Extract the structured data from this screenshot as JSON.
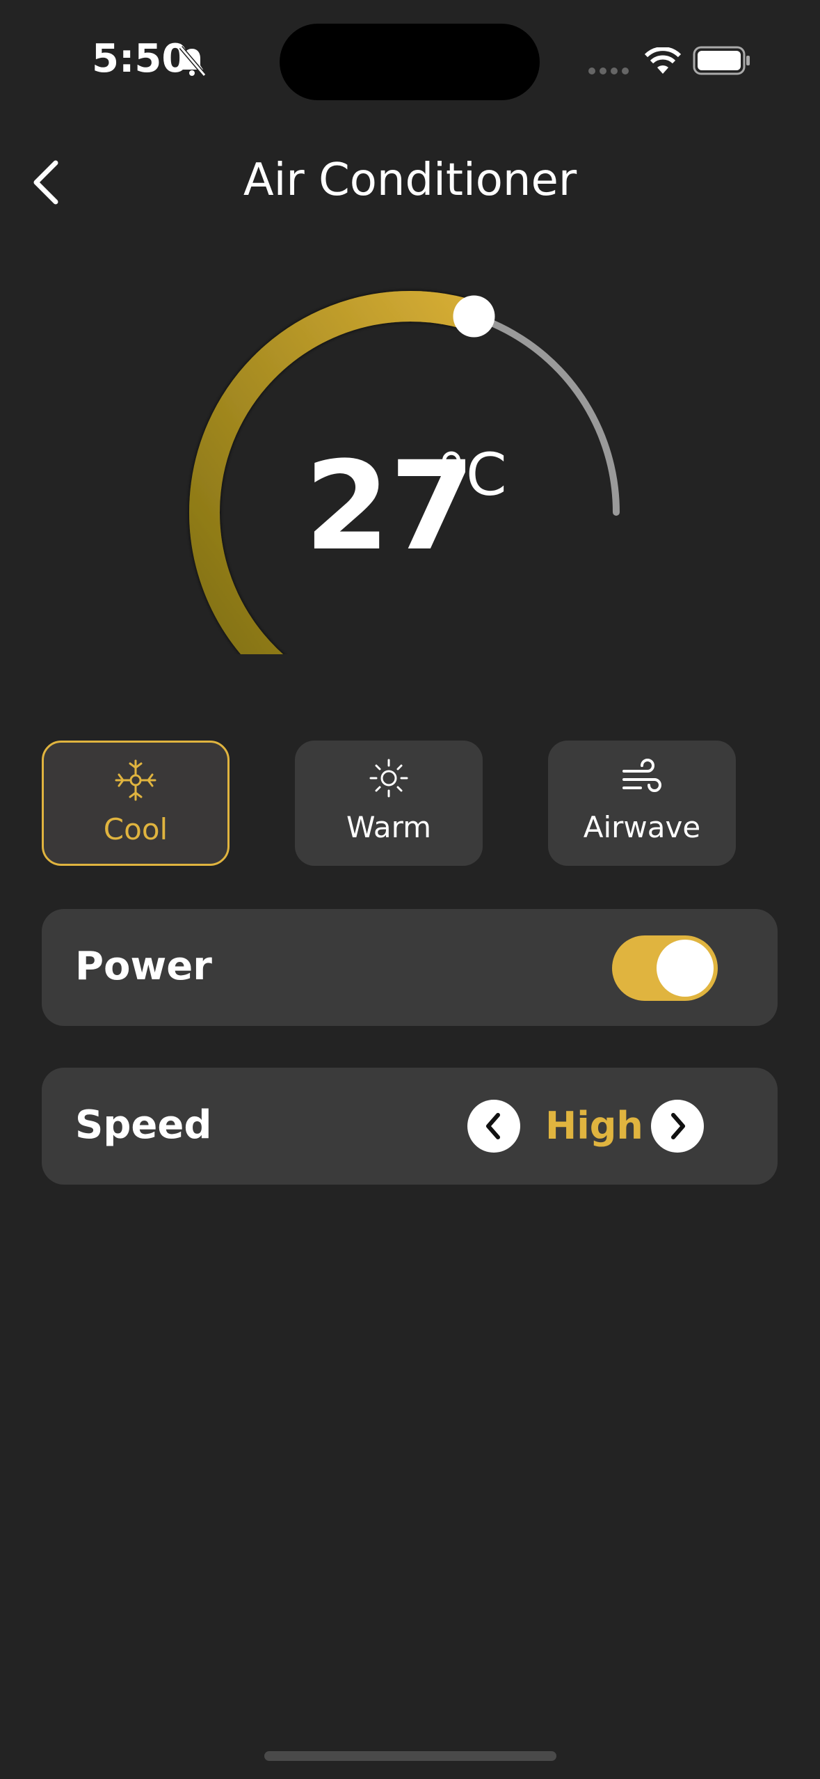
{
  "status_bar": {
    "time": "5:50"
  },
  "header": {
    "title": "Air Conditioner"
  },
  "thermostat": {
    "value": "27",
    "unit": "°C",
    "level": 0.7
  },
  "modes": [
    {
      "label": "Cool",
      "icon": "snowflake-icon",
      "selected": true
    },
    {
      "label": "Warm",
      "icon": "sun-icon",
      "selected": false
    },
    {
      "label": "Airwave",
      "icon": "wind-icon",
      "selected": false
    }
  ],
  "power": {
    "label": "Power",
    "on": true
  },
  "speed": {
    "label": "Speed",
    "value": "High"
  },
  "colors": {
    "accent": "#e0b43f",
    "background": "#232323",
    "card": "#3b3b3b"
  }
}
